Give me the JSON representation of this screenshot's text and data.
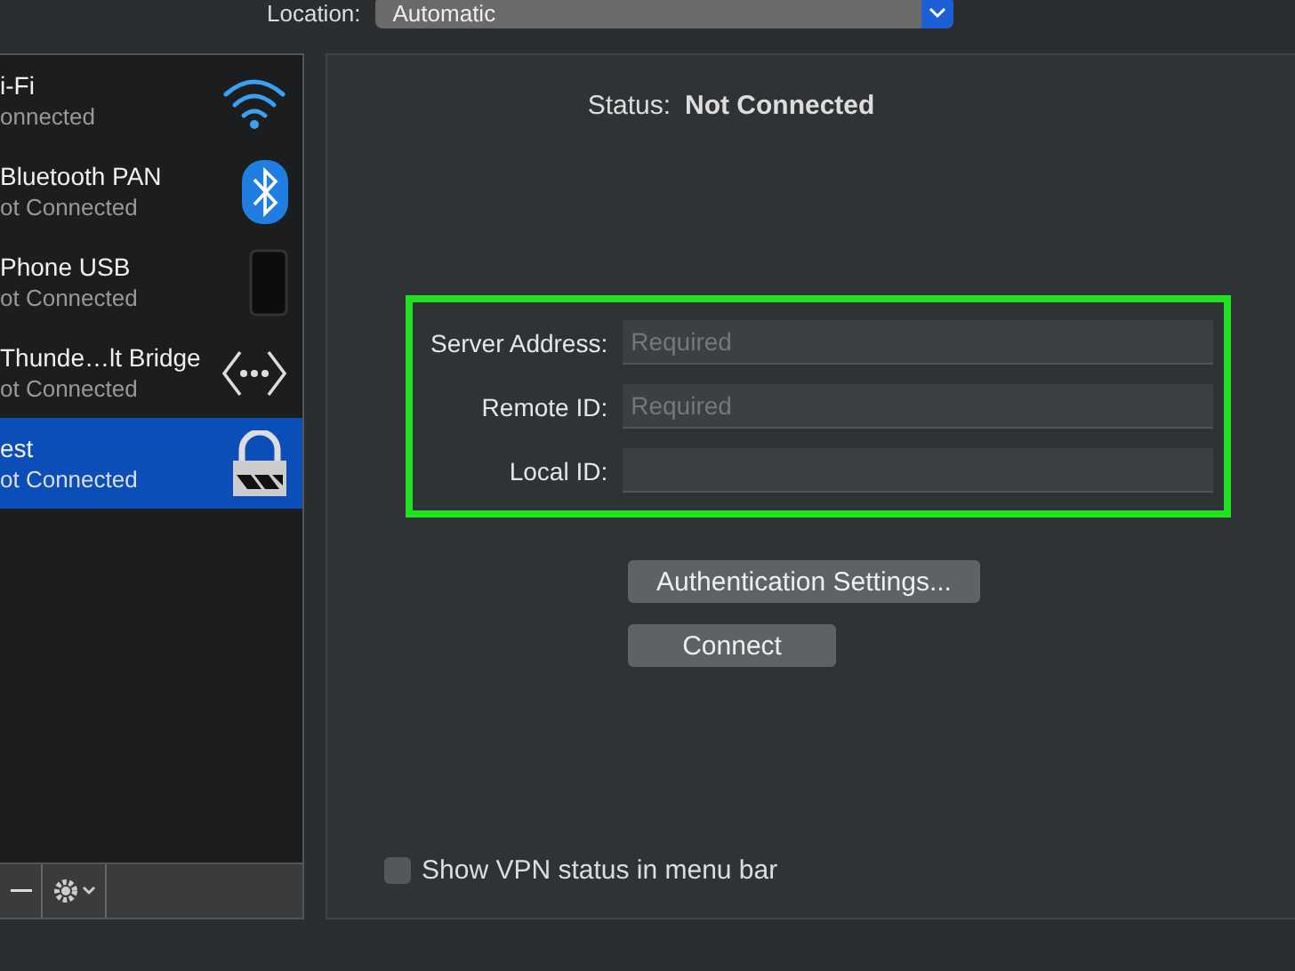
{
  "location": {
    "label": "Location:",
    "value": "Automatic"
  },
  "services": [
    {
      "name": "i-Fi",
      "status": "onnected",
      "kind": "wifi",
      "selected": false
    },
    {
      "name": "Bluetooth PAN",
      "status": "ot Connected",
      "kind": "bluetooth",
      "selected": false
    },
    {
      "name": "Phone USB",
      "status": "ot Connected",
      "kind": "phone",
      "selected": false
    },
    {
      "name": "Thunde…lt Bridge",
      "status": "ot Connected",
      "kind": "bridge",
      "selected": false
    },
    {
      "name": "est",
      "status": "ot Connected",
      "kind": "vpn",
      "selected": true
    }
  ],
  "status": {
    "label": "Status:",
    "value": "Not Connected"
  },
  "fields": [
    {
      "label": "Server Address:",
      "placeholder": "Required"
    },
    {
      "label": "Remote ID:",
      "placeholder": "Required"
    },
    {
      "label": "Local ID:"
    }
  ],
  "buttons": [
    "Authentication Settings...",
    "Connect"
  ],
  "show_vpn_status": {
    "label": "Show VPN status in menu bar",
    "checked": false
  }
}
